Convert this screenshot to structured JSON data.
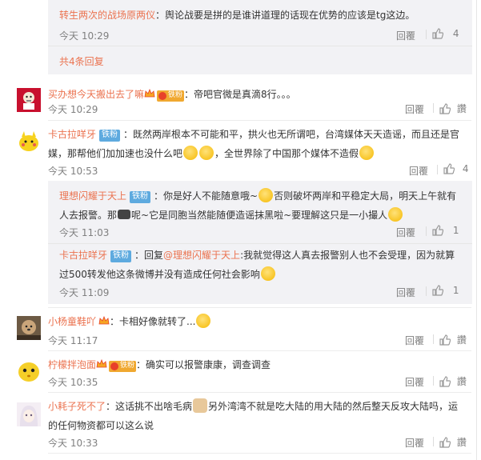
{
  "comments": [
    {
      "sub": true,
      "name": "转生两次的战场原两仪",
      "sep": "：",
      "text": "舆论战要是拼的是谁讲道理的话现在优势的应该是tg这边。",
      "time": "今天 10:29",
      "reply": "回覆",
      "likes": "4"
    },
    {
      "more": "共4条回复"
    },
    {
      "name": "买办想今天搬出去了嘛",
      "badge": "铁粉",
      "sep": "：",
      "text": "帝吧官微是真滴8行。。。",
      "time": "今天 10:29",
      "reply": "回覆",
      "likes": "讚"
    },
    {
      "name": "卡古拉咩牙",
      "badge": "铁粉",
      "sep": "：",
      "text1": "既然两岸根本不可能和平，拱火也无所谓吧，台湾媒体天天造谣，而且还是官",
      "text2a": "媒，那帮他们加加速也没什么吧",
      "text2b": "，全世界除了中国那个媒体不造假",
      "time": "今天 10:53",
      "reply": "回覆",
      "likes": "4"
    },
    {
      "sub": true,
      "name": "理想闪耀于天上",
      "badge": "铁粉",
      "sep": "：",
      "text1a": "你是好人不能随意哦~",
      "text1b": "否则破坏两岸和平稳定大局，明天上午就有",
      "text2a": "人去报警。那",
      "text2b": "呢~它是同胞当然能随便造谣抹黑啦~要理解这只是一小撮人",
      "time": "今天 11:03",
      "reply": "回覆",
      "likes": "1"
    },
    {
      "sub": true,
      "name": "卡古拉咩牙",
      "badge": "铁粉",
      "sep": "：",
      "reply_prefix": "回复",
      "reply_target": "@理想闪耀于天上",
      "text1": ":我就觉得这人真去报警别人也不会受理，因为就算",
      "text2": "过500转发他这条微博并没有造成任何社会影响",
      "time": "今天 11:09",
      "reply": "回覆",
      "likes": "1"
    },
    {
      "name": "小杨童鞋吖",
      "sep": "：",
      "text": "卡相好像就转了...",
      "time": "今天 11:17",
      "reply": "回覆",
      "likes": "讚"
    },
    {
      "name": "柠檬拌泡面",
      "badge": "铁粉",
      "sep": "：",
      "text": "确实可以报警康康，调查调查",
      "time": "今天 10:35",
      "reply": "回覆",
      "likes": "讚"
    },
    {
      "name": "小耗子死不了",
      "sep": "：",
      "text1a": "这话挑不出啥毛病",
      "text1b": "另外湾湾不就是吃大陆的用大陆的然后整天反攻大陆吗，运",
      "text2": "的任何物资都可以这么说",
      "time": "今天 10:33",
      "reply": "回覆",
      "likes": "讚"
    }
  ],
  "colors": {
    "name": "#eb7350",
    "subbox_bg": "#f2f2f5",
    "fan_badge": "#5eaadf",
    "time": "#808080"
  }
}
